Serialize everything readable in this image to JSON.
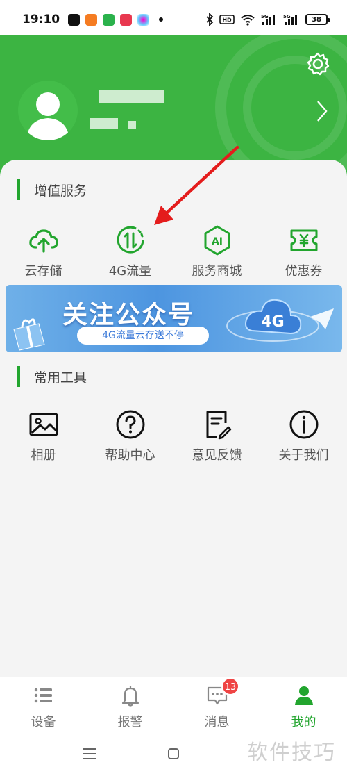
{
  "status": {
    "time": "19:10",
    "battery": "38"
  },
  "colors": {
    "brand_green": "#3cb442",
    "accent_green": "#22a52e",
    "badge_red": "#ef4444"
  },
  "sections": {
    "value_added": {
      "title": "增值服务",
      "items": [
        {
          "label": "云存储",
          "icon": "cloud-upload-icon"
        },
        {
          "label": "4G流量",
          "icon": "data-traffic-icon"
        },
        {
          "label": "服务商城",
          "icon": "ai-store-icon"
        },
        {
          "label": "优惠券",
          "icon": "coupon-icon"
        }
      ]
    },
    "tools": {
      "title": "常用工具",
      "items": [
        {
          "label": "相册",
          "icon": "album-icon"
        },
        {
          "label": "帮助中心",
          "icon": "help-icon"
        },
        {
          "label": "意见反馈",
          "icon": "feedback-icon"
        },
        {
          "label": "关于我们",
          "icon": "info-icon"
        }
      ]
    }
  },
  "banner": {
    "title": "关注公众号",
    "subtitle": "4G流量云存送不停",
    "badge": "4G"
  },
  "tabbar": {
    "items": [
      {
        "label": "设备",
        "icon": "device-list-icon"
      },
      {
        "label": "报警",
        "icon": "bell-icon"
      },
      {
        "label": "消息",
        "icon": "message-icon",
        "badge": "13"
      },
      {
        "label": "我的",
        "icon": "profile-icon",
        "active": true
      }
    ]
  },
  "watermark": "软件技巧"
}
